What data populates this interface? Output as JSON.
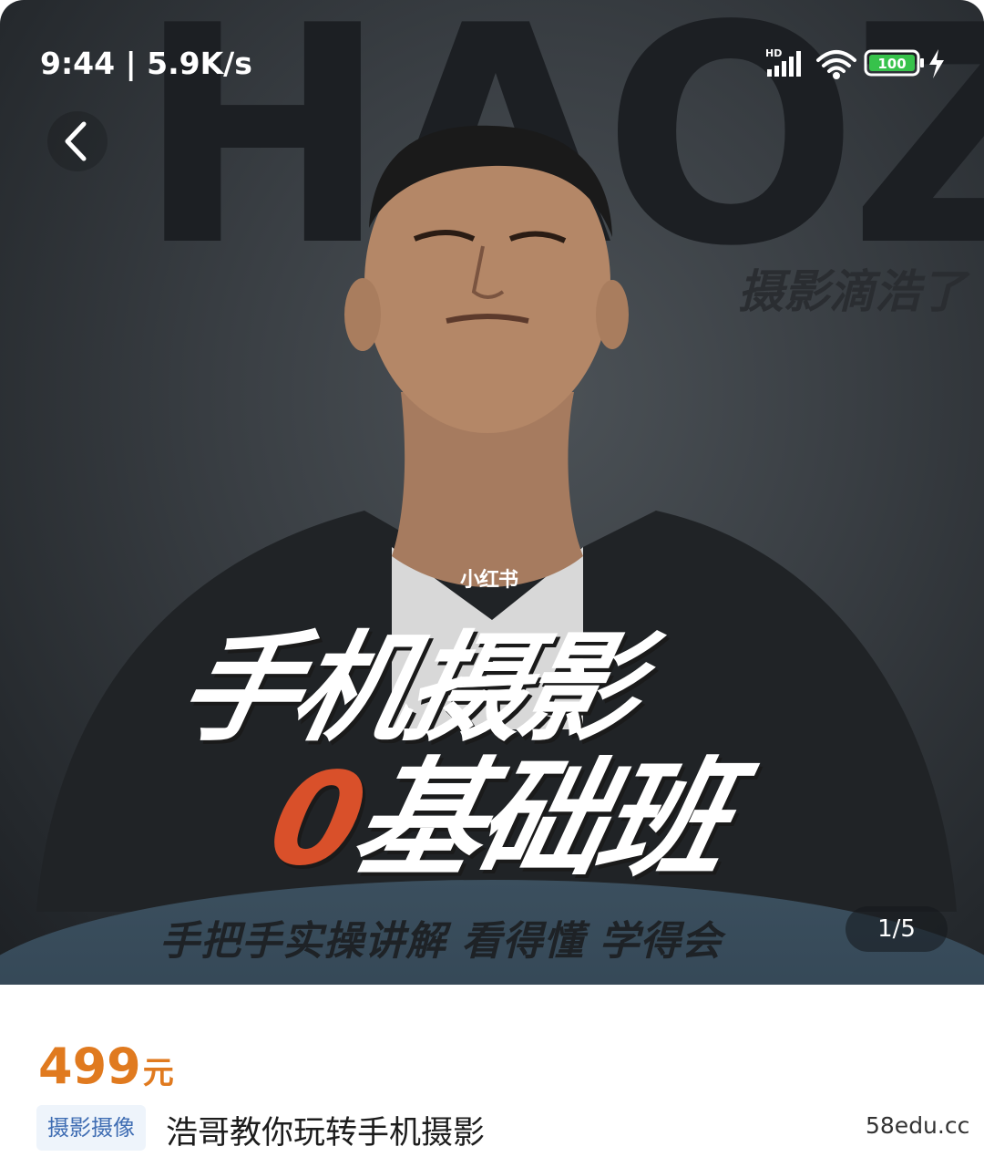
{
  "status_bar": {
    "time_speed": "9:44 | 5.9K/s",
    "network": "HD",
    "battery": "100"
  },
  "hero": {
    "bg_text": "HAOZI",
    "brand": "摄影滴浩了",
    "watermark": "小红书",
    "title_line1": "手机摄影",
    "title_zero": "0",
    "title_line2": "基础班",
    "tagline": "手把手实操讲解 看得懂 学得会",
    "counter": "1/5"
  },
  "product": {
    "price": "499",
    "price_unit": "元",
    "category": "摄影摄像",
    "title": "浩哥教你玩转手机摄影"
  },
  "footer": {
    "site_mark": "58edu.cc"
  },
  "colors": {
    "price": "#e07a1f",
    "badge_text": "#3f6db3",
    "accent_zero": "#d9502a"
  },
  "icons": [
    "back-arrow-icon",
    "signal-icon",
    "wifi-icon",
    "battery-icon",
    "charging-icon"
  ]
}
